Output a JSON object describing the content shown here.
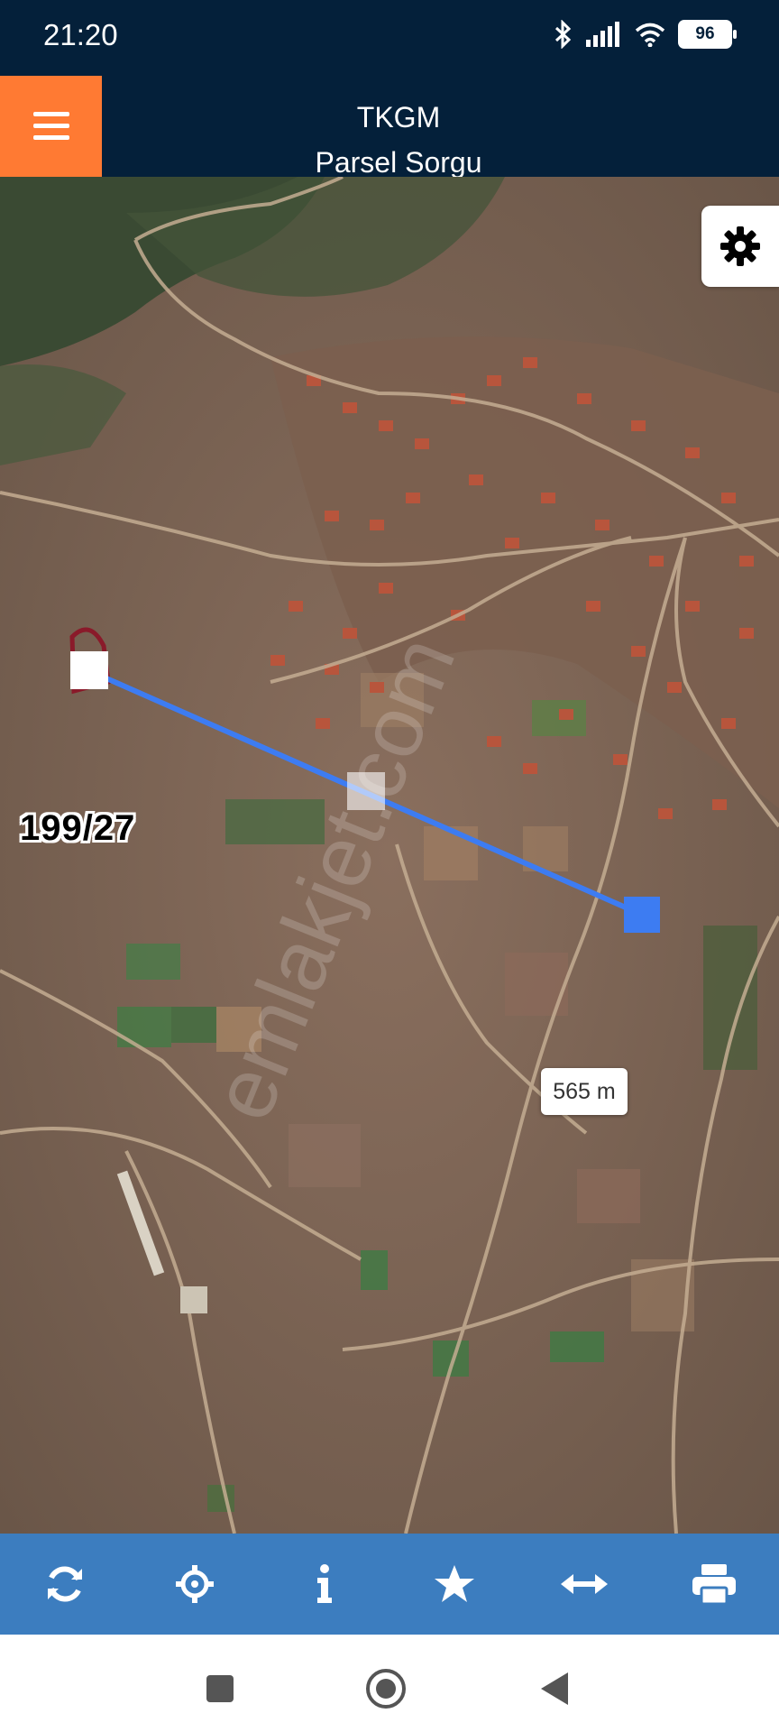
{
  "status": {
    "time": "21:20",
    "battery": "96"
  },
  "header": {
    "title": "TKGM",
    "subtitle": "Parsel Sorgu"
  },
  "map": {
    "parcel_label": "199/27",
    "distance_label": "565 m",
    "watermark": "emlakjet.com"
  },
  "toolbar": {
    "buttons": [
      "refresh-icon",
      "locate-crosshair-icon",
      "info-icon",
      "star-icon",
      "measure-arrows-icon",
      "print-icon"
    ]
  },
  "colors": {
    "header_bg": "#04203a",
    "menu_accent": "#ff7a33",
    "toolbar_bg": "#3c7dbf",
    "measure_line": "#3d7cf2"
  }
}
